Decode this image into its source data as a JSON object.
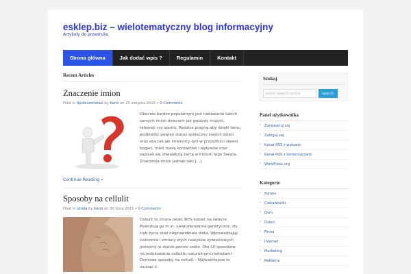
{
  "header": {
    "title": "esklep.biz – wielotematyczny blog informacyjny",
    "description": "Artykuły do przedruku"
  },
  "nav": {
    "items": [
      "Strona główna",
      "Jak dodać wpis ?",
      "Regulamin",
      "Kontakt"
    ]
  },
  "main": {
    "section_title": "Recent Articles",
    "posts": [
      {
        "title": "Znaczenie imion",
        "filed_in": "Filed in",
        "category": "Społeczeństwo",
        "by": "by",
        "author": "Karol",
        "on": "on 25 sierpnia 2015",
        "bullet": "•",
        "comments": "0 Comments",
        "excerpt": "Obecnie bardzo popularnym jest nadawanie takich samych imion dzieciom jak gwiazdy muzyki, telewizji czy sportu. Rodzice pragną aby dzięki temu podkreślić pewien status społeczny swoich dzieci oraz aby tak jak imiennicy byli w przyszłości sławni, bogaci, mieli masę kontaktów i wpływów oraz zapisali się chwalebną kartą w historii tego Świata. Znaczenia imion jednak taki [...]",
        "continue": "Continue Reading »"
      },
      {
        "title": "Sposoby na cellulit",
        "filed_in": "Filed in",
        "category": "Uroda",
        "by": "by",
        "author": "Karol",
        "on": "on 30 lipca 2015",
        "bullet": "•",
        "comments": "0 Comments",
        "excerpt": "Cellulit to zmora około 90% kobiet na świecie. Powodują go m.in. uwarunkowania genetyczne, zły tryb życia oraz nieprawidłowa dieta. Wprowadzając ćwiczenia i zmiany złych nawyków żywieniowych jesteśmy w stanie pomóc sobie. Oto 10 sposobów na redukowanie cellulitu naturalnymi metodami. Domowe sposoby na cellulit – Najważniejsze to usunąć z"
      }
    ]
  },
  "sidebar": {
    "search": {
      "title": "Szukaj",
      "placeholder": "enter search terms",
      "button": "search"
    },
    "user_panel": {
      "title": "Panel użytkownika",
      "items": [
        "Zarejestruj się",
        "Zaloguj się",
        "Kanał RSS z wpisami",
        "Kanał RSS z komentarzami",
        "WordPress.org"
      ]
    },
    "categories": {
      "title": "Kategorie",
      "items": [
        "Biznes",
        "Ciekawostki",
        "Dom",
        "Dzieci",
        "Firma",
        "Internet",
        "Marketing",
        "Reklama"
      ]
    }
  },
  "colors": {
    "brand": "#2a34d8",
    "nav_bg": "#222222",
    "nav_active": "#2a53e8",
    "link": "#2a5db0",
    "search_button": "#2a9fd6"
  }
}
